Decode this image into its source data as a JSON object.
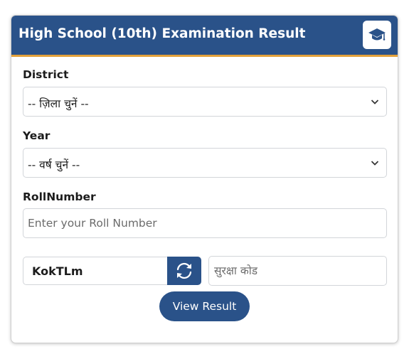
{
  "header": {
    "title": "High School (10th) Examination Result",
    "icon": "graduation-cap-icon"
  },
  "district": {
    "label": "District",
    "selected": "-- ज़िला चुनें --"
  },
  "year": {
    "label": "Year",
    "selected": "-- वर्ष चुनें --"
  },
  "roll": {
    "label": "RollNumber",
    "placeholder": "Enter your Roll Number",
    "value": ""
  },
  "captcha": {
    "code": "KokTLm",
    "refresh_icon": "refresh-icon",
    "input_placeholder": "सुरक्षा कोड"
  },
  "submit": {
    "label": "View Result"
  },
  "colors": {
    "primary": "#2a5289",
    "header_accent": "#e3a13a",
    "border": "#d2d5d9"
  }
}
